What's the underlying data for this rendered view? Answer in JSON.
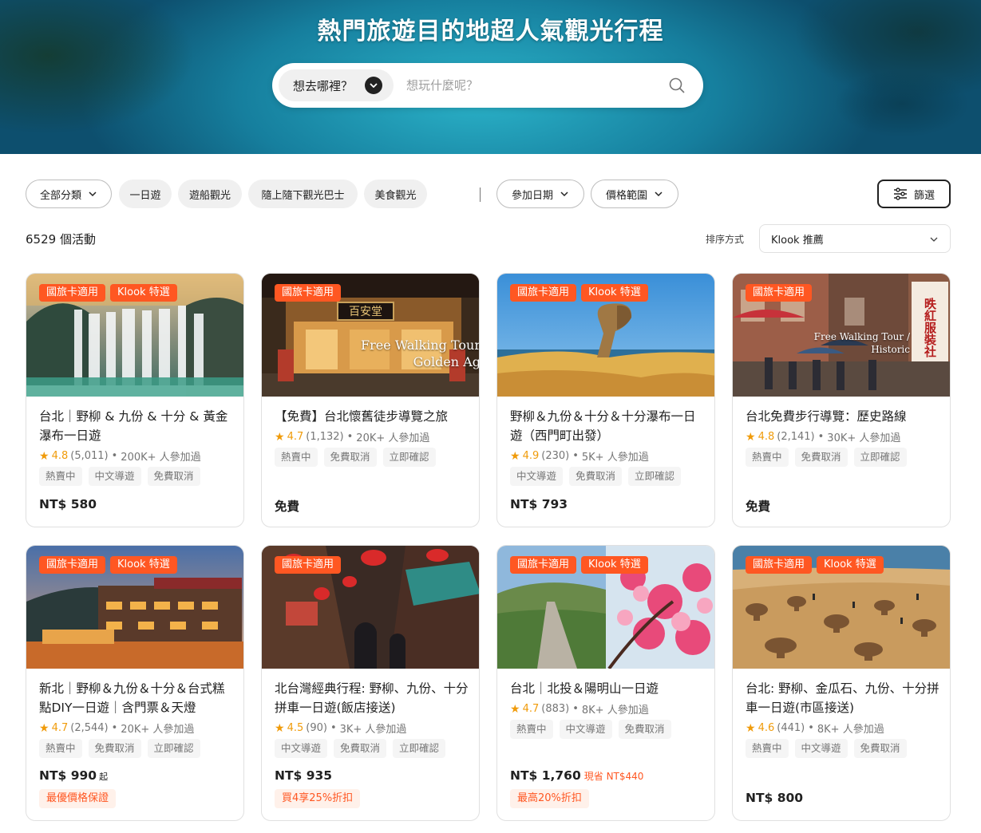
{
  "hero": {
    "title": "熱門旅遊目的地超人氣觀光行程",
    "destination_label": "想去哪裡？",
    "search_placeholder": "想玩什麼呢？"
  },
  "filters": {
    "category": "全部分類",
    "chips": [
      "一日遊",
      "遊船觀光",
      "隨上隨下觀光巴士",
      "美食觀光"
    ],
    "date": "參加日期",
    "price_range": "價格範圍",
    "filter_button": "篩選"
  },
  "results": {
    "count": "6529 個活動",
    "sort_label": "排序方式",
    "sort_value": "Klook 推薦"
  },
  "colors": {
    "accent": "#ff5722",
    "star": "#f09b0a"
  },
  "cards": [
    {
      "tags": [
        "國旅卡適用",
        "Klook 特選"
      ],
      "title": "台北｜野柳 & 九份 & 十分 & 黃金瀑布一日遊",
      "rating": "4.8",
      "reviews": "(5,011)",
      "participants": "200K+ 人參加過",
      "chips": [
        "熱賣中",
        "中文導遊",
        "免費取消"
      ],
      "price": "NT$ 580"
    },
    {
      "tags": [
        "國旅卡適用"
      ],
      "caption": "Free Walking Tour\nGolden Ag",
      "sign": "百安堂",
      "title": "【免費】台北懷舊徒步導覽之旅",
      "rating": "4.7",
      "reviews": "(1,132)",
      "participants": "20K+ 人參加過",
      "chips": [
        "熱賣中",
        "免費取消",
        "立即確認"
      ],
      "price": "免費"
    },
    {
      "tags": [
        "國旅卡適用",
        "Klook 特選"
      ],
      "title": "野柳＆九份＆十分＆十分瀑布一日遊（西門町出發）",
      "rating": "4.9",
      "reviews": "(230)",
      "participants": "5K+ 人參加過",
      "chips": [
        "中文導遊",
        "免費取消",
        "立即確認"
      ],
      "price": "NT$ 793"
    },
    {
      "tags": [
        "國旅卡適用"
      ],
      "caption": "Free Walking Tour /\nHistoric",
      "sign": "昳紅服裝社",
      "title": "台北免費步行導覽：歷史路線",
      "rating": "4.8",
      "reviews": "(2,141)",
      "participants": "30K+ 人參加過",
      "chips": [
        "熱賣中",
        "免費取消",
        "立即確認"
      ],
      "price": "免費"
    },
    {
      "tags": [
        "國旅卡適用",
        "Klook 特選"
      ],
      "title": "新北｜野柳＆九份＆十分＆台式糕點DIY一日遊｜含門票＆天燈",
      "rating": "4.7",
      "reviews": "(2,544)",
      "participants": "20K+ 人參加過",
      "chips": [
        "熱賣中",
        "免費取消",
        "立即確認"
      ],
      "price": "NT$ 990",
      "price_suffix": "起",
      "promo": "最優價格保證"
    },
    {
      "tags": [
        "國旅卡適用"
      ],
      "title": "北台灣經典行程: 野柳、九份、十分拼車一日遊(飯店接送)",
      "rating": "4.5",
      "reviews": "(90)",
      "participants": "3K+ 人參加過",
      "chips": [
        "中文導遊",
        "免費取消",
        "立即確認"
      ],
      "price": "NT$ 935",
      "promo": "買4享25%折扣"
    },
    {
      "tags": [
        "國旅卡適用",
        "Klook 特選"
      ],
      "title": "台北｜北投＆陽明山一日遊",
      "rating": "4.7",
      "reviews": "(883)",
      "participants": "8K+ 人參加過",
      "chips": [
        "熱賣中",
        "中文導遊",
        "免費取消"
      ],
      "price": "NT$ 1,760",
      "price_save": "現省 NT$440",
      "promo": "最高20%折扣"
    },
    {
      "tags": [
        "國旅卡適用",
        "Klook 特選"
      ],
      "title": "台北: 野柳、金瓜石、九份、十分拼車一日遊(市區接送)",
      "rating": "4.6",
      "reviews": "(441)",
      "participants": "8K+ 人參加過",
      "chips": [
        "熱賣中",
        "中文導遊",
        "免費取消"
      ],
      "price": "NT$ 800"
    }
  ]
}
